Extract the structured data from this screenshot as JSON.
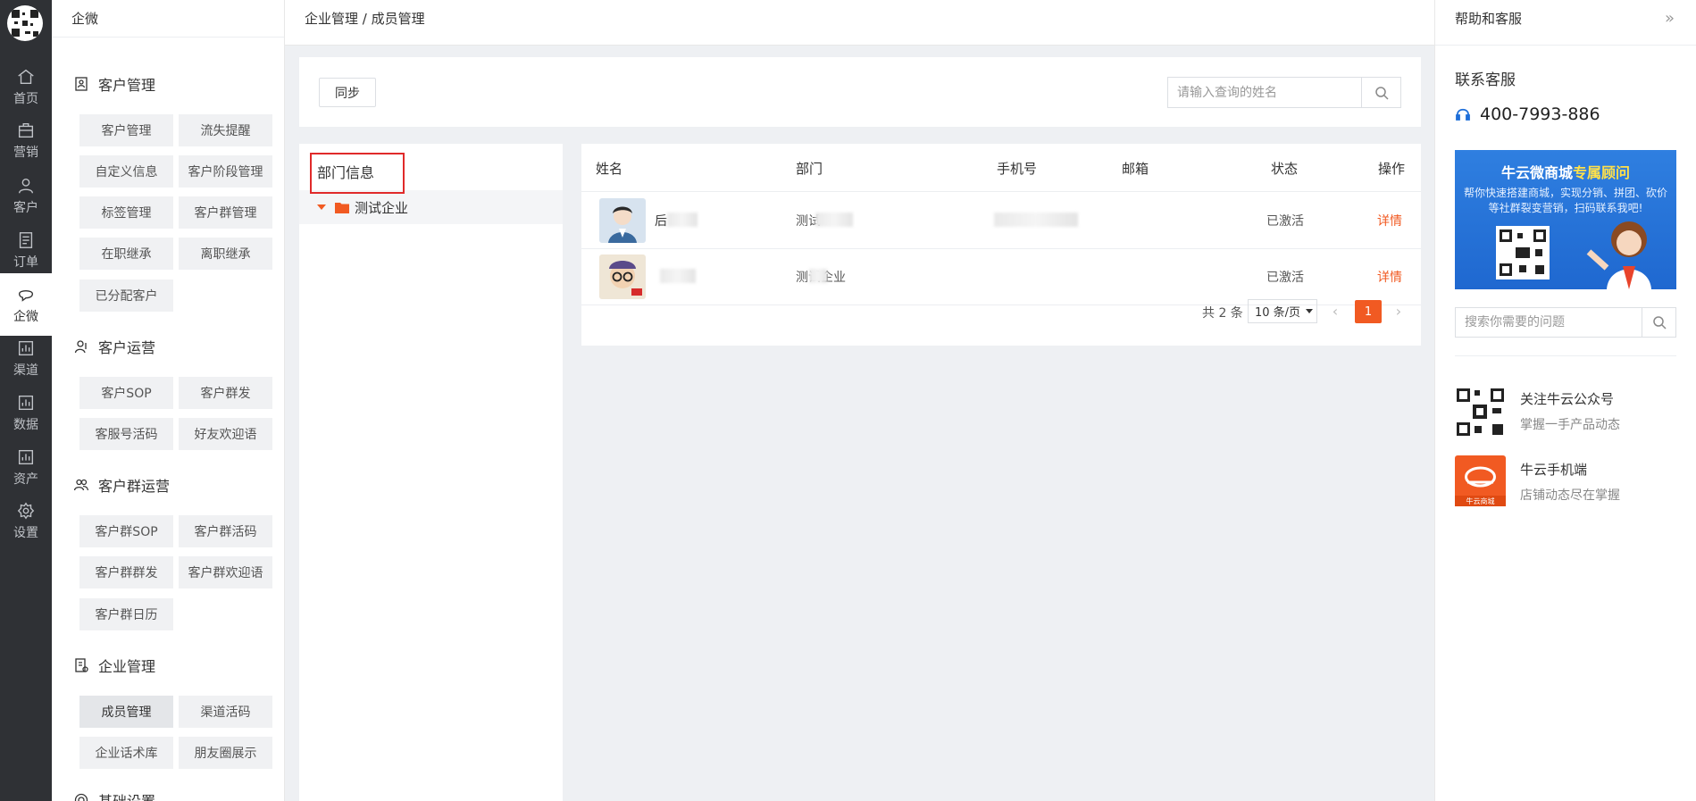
{
  "rail": {
    "items": [
      {
        "label": "首页",
        "icon": "home-icon"
      },
      {
        "label": "营销",
        "icon": "briefcase-icon"
      },
      {
        "label": "客户",
        "icon": "user-icon"
      },
      {
        "label": "订单",
        "icon": "document-icon"
      },
      {
        "label": "企微",
        "icon": "chat-icon"
      },
      {
        "label": "渠道",
        "icon": "chart-icon"
      },
      {
        "label": "数据",
        "icon": "chart-icon"
      },
      {
        "label": "资产",
        "icon": "chart-icon"
      },
      {
        "label": "设置",
        "icon": "gear-icon"
      }
    ],
    "active_index": 4
  },
  "menu": {
    "title": "企微",
    "groups": [
      {
        "title": "客户管理",
        "buttons": [
          "客户管理",
          "流失提醒",
          "自定义信息",
          "客户阶段管理",
          "标签管理",
          "客户群管理",
          "在职继承",
          "离职继承",
          "已分配客户"
        ]
      },
      {
        "title": "客户运营",
        "buttons": [
          "客户SOP",
          "客户群发",
          "客服号活码",
          "好友欢迎语"
        ]
      },
      {
        "title": "客户群运营",
        "buttons": [
          "客户群SOP",
          "客户群活码",
          "客户群群发",
          "客户群欢迎语",
          "客户群日历"
        ]
      },
      {
        "title": "企业管理",
        "buttons": [
          "成员管理",
          "渠道活码",
          "企业话术库",
          "朋友圈展示"
        ]
      },
      {
        "title": "基础设置",
        "buttons": []
      }
    ],
    "active_button": "成员管理"
  },
  "header": {
    "breadcrumb": "企业管理 / 成员管理"
  },
  "toolbar": {
    "sync_label": "同步",
    "search_placeholder": "请输入查询的姓名"
  },
  "dept": {
    "title": "部门信息",
    "node": "测试企业"
  },
  "table": {
    "headers": [
      "姓名",
      "部门",
      "手机号",
      "邮箱",
      "状态",
      "操作"
    ],
    "rows": [
      {
        "name_visible": "后",
        "dept_visible": "测试",
        "status": "已激活",
        "action": "详情"
      },
      {
        "name_visible": "",
        "dept_visible": "测试企业",
        "status": "已激活",
        "action": "详情"
      }
    ],
    "pager": {
      "total": "共 2 条",
      "page_size": "10 条/页",
      "current": "1"
    }
  },
  "help": {
    "title": "帮助和客服",
    "contact_title": "联系客服",
    "phone": "400-7993-886",
    "banner_title_a": "牛云微商城",
    "banner_title_b": "专属顾问",
    "banner_text": "帮你快速搭建商城，实现分销、拼团、砍价等社群裂变营销，扫码联系我吧!",
    "search_placeholder": "搜索你需要的问题",
    "cards": [
      {
        "title": "关注牛云公众号",
        "sub": "掌握一手产品动态",
        "icon": "qrcode-icon"
      },
      {
        "title": "牛云手机端",
        "sub": "店铺动态尽在掌握",
        "icon": "mobile-app-icon",
        "icon_label": "牛云商城"
      }
    ]
  },
  "colors": {
    "accent": "#f15a22",
    "rail": "#2f3135",
    "highlight_box": "#e02a2a"
  }
}
